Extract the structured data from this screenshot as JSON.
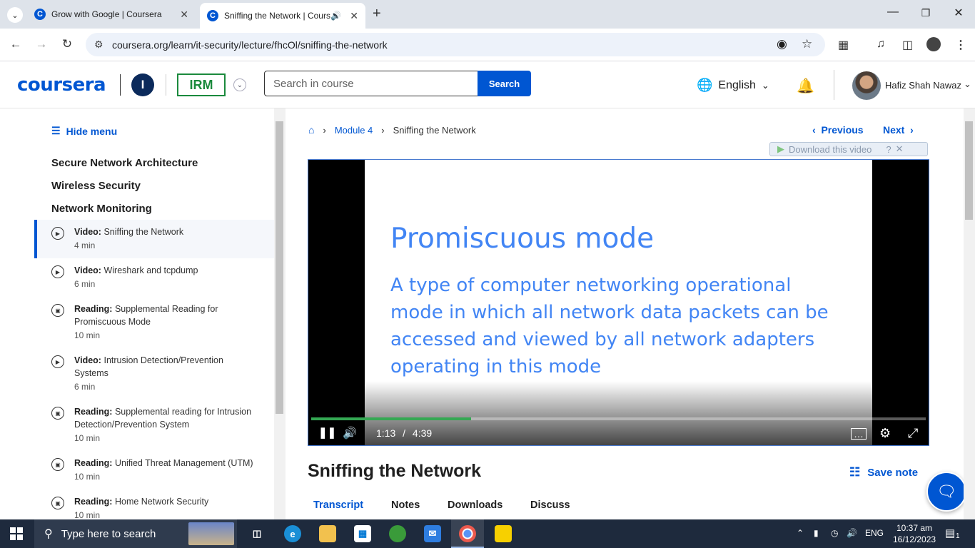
{
  "browser": {
    "tabs": [
      {
        "title": "Grow with Google | Coursera",
        "favicon": "coursera-icon"
      },
      {
        "title": "Sniffing the Network | Cours",
        "favicon": "coursera-icon",
        "active": true,
        "audio": true
      }
    ],
    "new_tab": "+",
    "url": "coursera.org/learn/it-security/lecture/fhcOl/sniffing-the-network"
  },
  "header": {
    "logo": "coursera",
    "partner_initial": "I",
    "partner_logo": "IRM",
    "search": {
      "placeholder": "Search in course",
      "button": "Search"
    },
    "language": "English",
    "user_name": "Hafiz Shah Nawaz"
  },
  "sidebar": {
    "hide_menu": "Hide menu",
    "sections": [
      "Secure Network Architecture",
      "Wireless Security",
      "Network Monitoring"
    ],
    "items": [
      {
        "type": "Video:",
        "title": "Sniffing the Network",
        "duration": "4 min",
        "icon": "play-icon",
        "active": true
      },
      {
        "type": "Video:",
        "title": "Wireshark and tcpdump",
        "duration": "6 min",
        "icon": "play-icon"
      },
      {
        "type": "Reading:",
        "title": "Supplemental Reading for Promiscuous Mode",
        "duration": "10 min",
        "icon": "book-icon"
      },
      {
        "type": "Video:",
        "title": "Intrusion Detection/Prevention Systems",
        "duration": "6 min",
        "icon": "play-icon"
      },
      {
        "type": "Reading:",
        "title": "Supplemental reading for Intrusion Detection/Prevention System",
        "duration": "10 min",
        "icon": "book-icon"
      },
      {
        "type": "Reading:",
        "title": "Unified Threat Management (UTM)",
        "duration": "10 min",
        "icon": "book-icon"
      },
      {
        "type": "Reading:",
        "title": "Home Network Security",
        "duration": "10 min",
        "icon": "book-icon"
      }
    ]
  },
  "main": {
    "breadcrumb": {
      "module": "Module 4",
      "current": "Sniffing the Network"
    },
    "previous": "Previous",
    "next": "Next",
    "download_video": "Download this video",
    "video": {
      "slide_title": "Promiscuous mode",
      "slide_body": "A type of computer networking operational mode in which all network data packets can be accessed and viewed by all network adapters operating in this mode",
      "current_time": "1:13",
      "separator": "/",
      "duration": "4:39",
      "progress": 0.26
    },
    "lecture_title": "Sniffing the Network",
    "save_note": "Save note",
    "content_tabs": [
      "Transcript",
      "Notes",
      "Downloads",
      "Discuss"
    ]
  },
  "taskbar": {
    "search_placeholder": "Type here to search",
    "language": "ENG",
    "time": "10:37 am",
    "date": "16/12/2023",
    "notifications": "1"
  },
  "colors": {
    "brand": "#0056d2",
    "slide_text": "#4285f4",
    "progress": "#34a853",
    "taskbar": "#1e2a3d"
  }
}
